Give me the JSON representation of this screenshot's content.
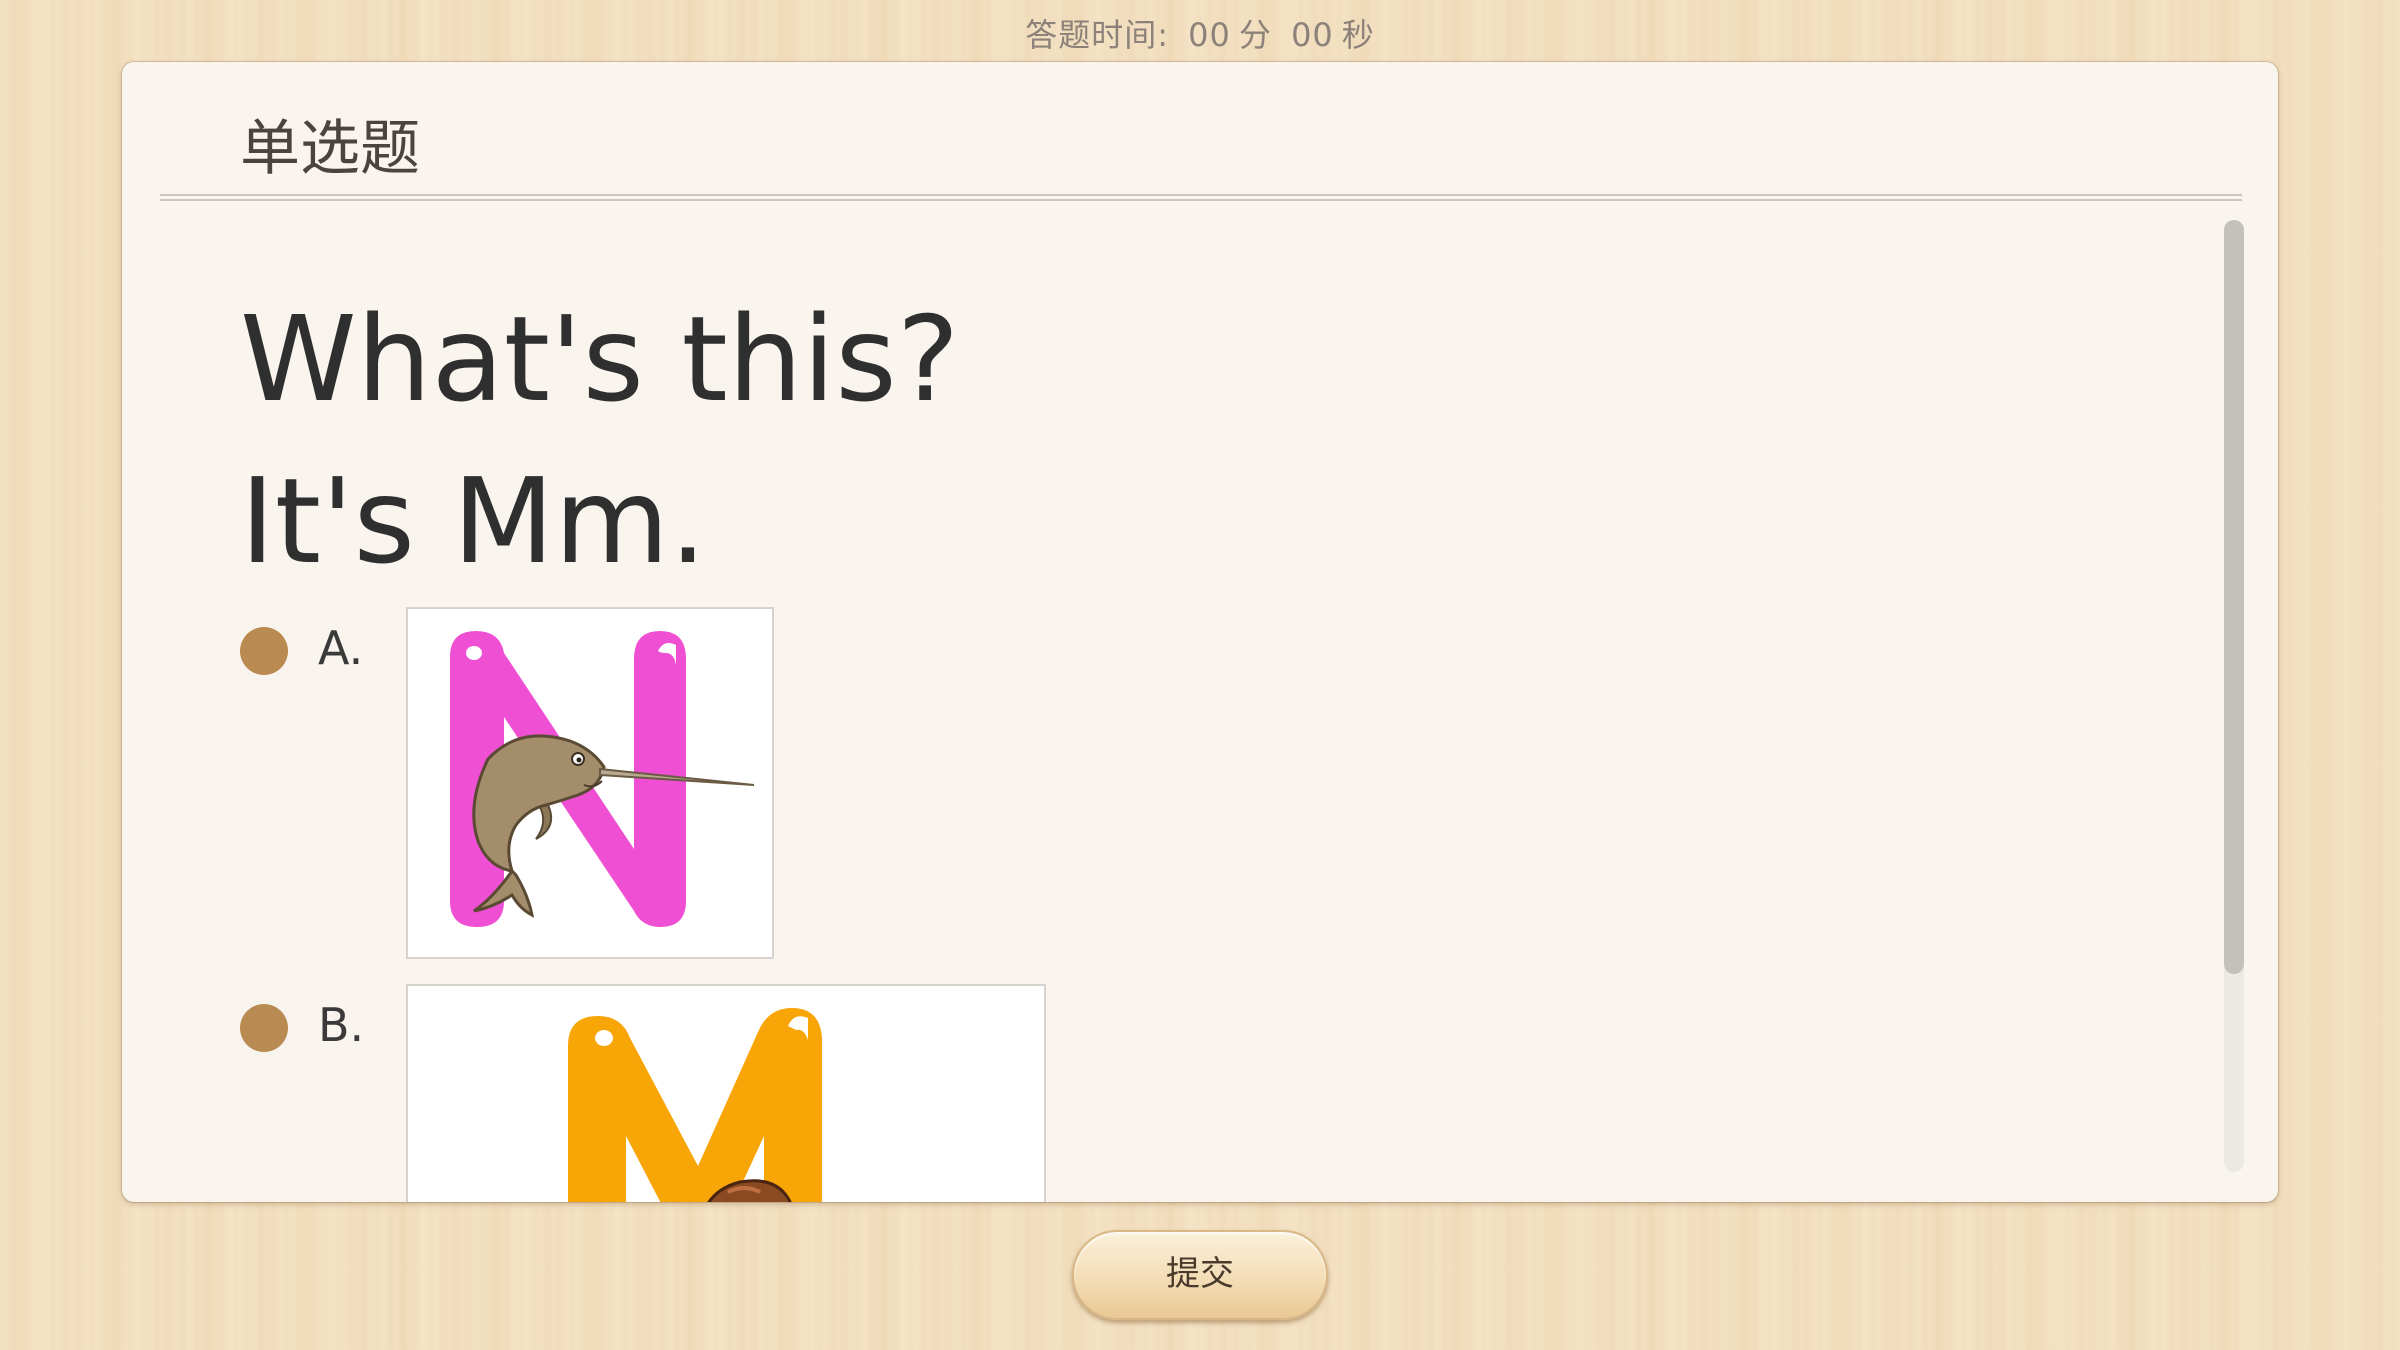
{
  "timer": {
    "label": "答题时间:",
    "minutes": "00",
    "minutes_unit": "分",
    "seconds": "00",
    "seconds_unit": "秒"
  },
  "question": {
    "type": "单选题",
    "stem_line1": "What's this?",
    "stem_line2": "It's Mm."
  },
  "options": [
    {
      "label": "A.",
      "image": "letter-n-narwhal",
      "letter": "N",
      "letter_color": "#ef4fd3",
      "selected": false
    },
    {
      "label": "B.",
      "image": "letter-m-cartoon",
      "letter": "M",
      "letter_color": "#f8a507",
      "selected": false
    }
  ],
  "submit": {
    "label": "提交"
  },
  "colors": {
    "radio": "#b98a52",
    "card_bg": "#f9f5ee",
    "wood_bg": "#f4e2c4"
  }
}
